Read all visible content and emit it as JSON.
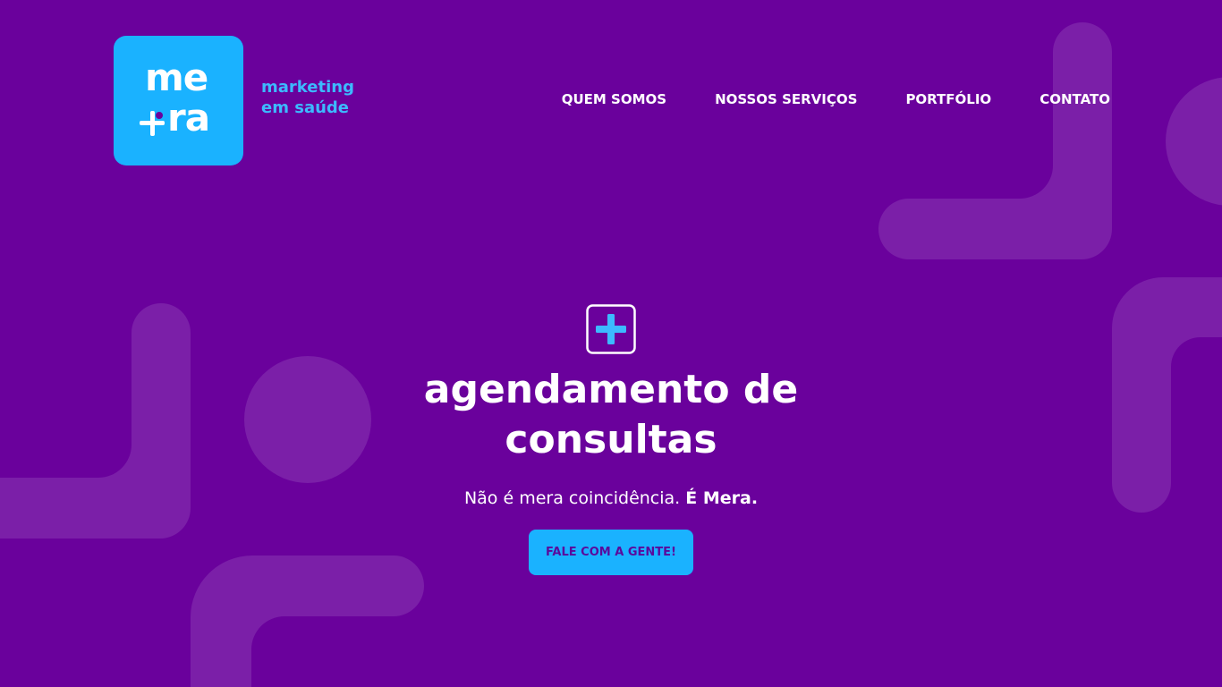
{
  "brand": {
    "logo_top": "me",
    "logo_bottom": "ra",
    "tagline_line1": "marketing",
    "tagline_line2": "em saúde",
    "colors": {
      "background": "#6a019c",
      "accent": "#1ab2ff",
      "decor": "#7b1fa8",
      "text": "#ffffff"
    }
  },
  "nav": {
    "items": [
      {
        "label": "QUEM SOMOS"
      },
      {
        "label": "NOSSOS SERVIÇOS"
      },
      {
        "label": "PORTFÓLIO"
      },
      {
        "label": "CONTATO"
      }
    ]
  },
  "hero": {
    "icon": "plus-square-icon",
    "title": "agendamento de consultas",
    "subtitle_plain": "Não é mera coincidência. ",
    "subtitle_bold": "É Mera.",
    "cta_label": "FALE COM A GENTE!"
  }
}
